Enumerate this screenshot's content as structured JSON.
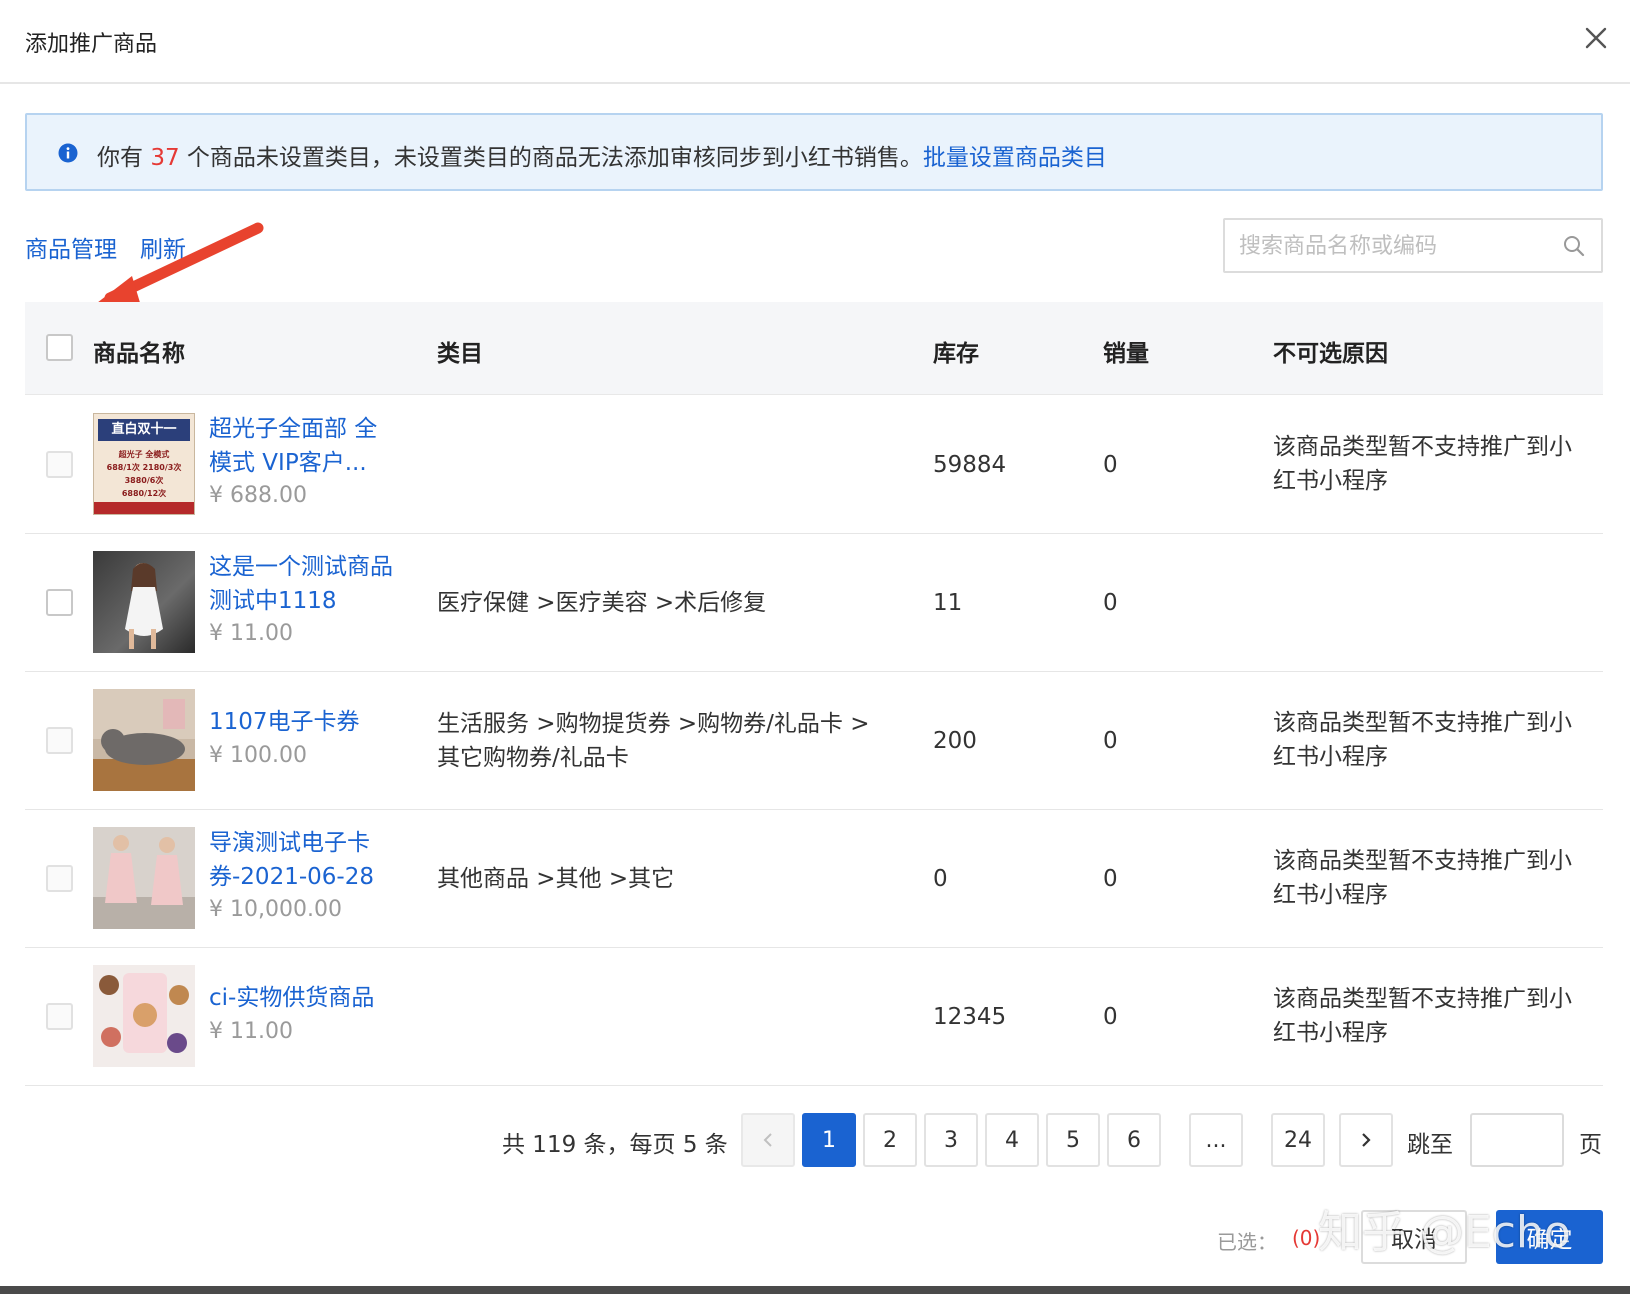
{
  "dialog": {
    "title": "添加推广商品"
  },
  "notice": {
    "prefix": "你有",
    "count": "37",
    "middle": "个商品未设置类目，未设置类目的商品无法添加审核同步到小红书销售。",
    "link": "批量设置商品类目"
  },
  "toolbar": {
    "manage": "商品管理",
    "refresh": "刷新"
  },
  "search": {
    "placeholder": "搜索商品名称或编码"
  },
  "table": {
    "headers": {
      "name": "商品名称",
      "category": "类目",
      "stock": "库存",
      "sales": "销量",
      "reason": "不可选原因"
    },
    "rows": [
      {
        "name": "超光子全面部 全模式 VIP客户...",
        "price": "¥ 688.00",
        "category": "",
        "stock": "59884",
        "sales": "0",
        "reason": "该商品类型暂不支持推广到小红书小程序",
        "thumb_title": "直白双十一",
        "thumb_lines": [
          "超光子 全模式",
          "688/1次 2180/3次",
          "3880/6次",
          "6880/12次"
        ]
      },
      {
        "name": "这是一个测试商品测试中1118",
        "price": "¥ 11.00",
        "category": "医疗保健 >医疗美容 >术后修复",
        "stock": "11",
        "sales": "0",
        "reason": ""
      },
      {
        "name": "1107电子卡券",
        "price": "¥ 100.00",
        "category": "生活服务 >购物提货券 >购物券/礼品卡 >其它购物券/礼品卡",
        "stock": "200",
        "sales": "0",
        "reason": "该商品类型暂不支持推广到小红书小程序"
      },
      {
        "name": "导演测试电子卡券-2021-06-28",
        "price": "¥ 10,000.00",
        "category": "其他商品 >其他 >其它",
        "stock": "0",
        "sales": "0",
        "reason": "该商品类型暂不支持推广到小红书小程序"
      },
      {
        "name": "ci-实物供货商品",
        "price": "¥ 11.00",
        "category": "",
        "stock": "12345",
        "sales": "0",
        "reason": "该商品类型暂不支持推广到小红书小程序"
      }
    ]
  },
  "pagination": {
    "total_text": "共 119 条，每页 5 条",
    "pages": [
      "1",
      "2",
      "3",
      "4",
      "5",
      "6",
      "...",
      "24"
    ],
    "current": "1",
    "jump_label": "跳至",
    "page_suffix": "页"
  },
  "footer": {
    "selected_label": "已选：",
    "selected_count": "(0)",
    "cancel": "取消",
    "confirm": "确定"
  },
  "watermark": "知乎 @Echo",
  "colors": {
    "primary": "#1a63d1",
    "highlight": "#e53935",
    "arrow": "#e8432e"
  }
}
